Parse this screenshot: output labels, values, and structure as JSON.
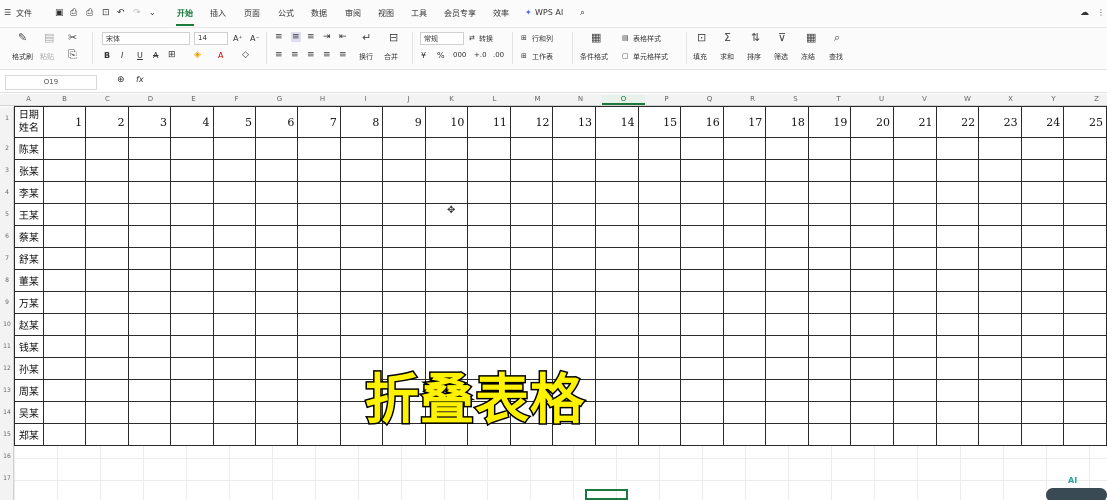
{
  "menu": {
    "file": "文件",
    "tabs": [
      "开始",
      "插入",
      "页面",
      "公式",
      "数据",
      "审阅",
      "视图",
      "工具",
      "会员专享",
      "效率"
    ],
    "ai": "WPS AI"
  },
  "toolbar": {
    "format_painter": "格式刷",
    "paste": "粘贴",
    "font": "宋体",
    "font_size": "14",
    "number_format": "常规",
    "convert": "转换",
    "rows_cols": "行和列",
    "worksheet": "工作表",
    "wrap": "换行",
    "merge": "合并",
    "cond_format": "条件格式",
    "table_style": "表格样式",
    "cell_style": "单元格样式",
    "fill": "填充",
    "sum": "求和",
    "sort": "排序",
    "filter": "筛选",
    "freeze": "冻结",
    "find": "查找"
  },
  "formula_bar": {
    "name_box": "O19",
    "fx": "fx"
  },
  "columns": [
    "A",
    "B",
    "C",
    "D",
    "E",
    "F",
    "G",
    "H",
    "I",
    "J",
    "K",
    "L",
    "M",
    "N",
    "O",
    "P",
    "Q",
    "R",
    "S",
    "T",
    "U",
    "V",
    "W",
    "X",
    "Y",
    "Z"
  ],
  "selected_column": "O",
  "rows": [
    "1",
    "2",
    "3",
    "4",
    "5",
    "6",
    "7",
    "8",
    "9",
    "10",
    "11",
    "12",
    "13",
    "14",
    "15",
    "16",
    "17"
  ],
  "table": {
    "corner_top": "日期",
    "corner_bottom": "姓名",
    "days": [
      "1",
      "2",
      "3",
      "4",
      "5",
      "6",
      "7",
      "8",
      "9",
      "10",
      "11",
      "12",
      "13",
      "14",
      "15",
      "16",
      "17",
      "18",
      "19",
      "20",
      "21",
      "22",
      "23",
      "24",
      "25"
    ],
    "names": [
      "陈某",
      "张某",
      "李某",
      "王某",
      "蔡某",
      "舒某",
      "董某",
      "万某",
      "赵某",
      "钱某",
      "孙某",
      "周某",
      "吴某",
      "郑某"
    ]
  },
  "overlay_caption": "折叠表格",
  "colors": {
    "accent": "#1a7a3c",
    "caption": "#fff200"
  }
}
